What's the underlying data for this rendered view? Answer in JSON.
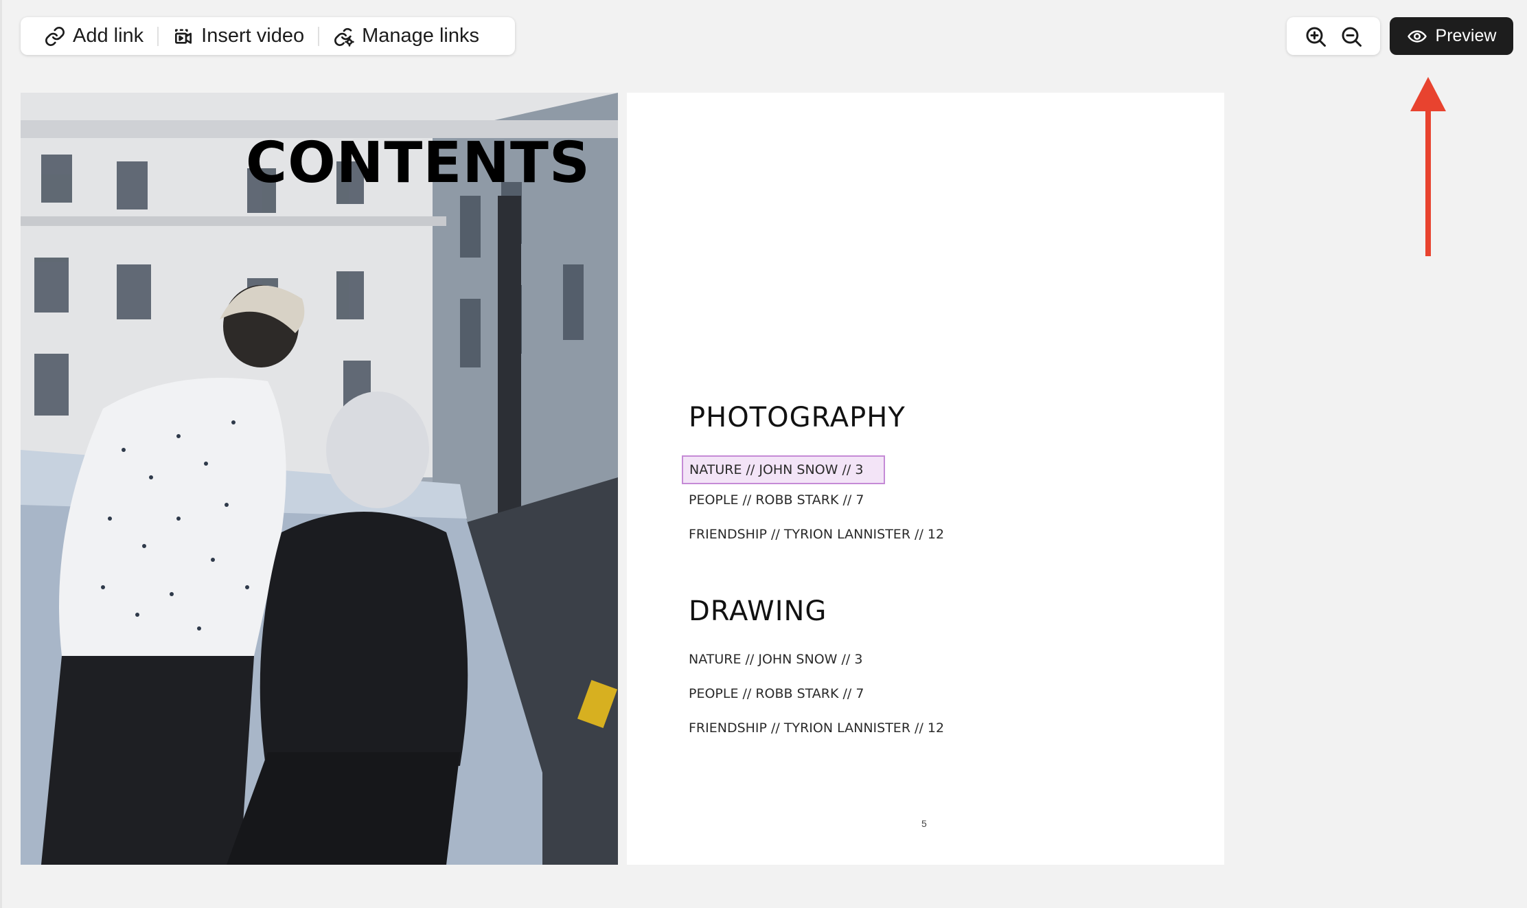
{
  "toolbar": {
    "add_link": "Add link",
    "insert_video": "Insert video",
    "manage_links": "Manage links"
  },
  "preview": {
    "label": "Preview"
  },
  "annotation": {
    "arrow_color": "#e8432f"
  },
  "left_page": {
    "title": "CONTENTS"
  },
  "right_page": {
    "sections": [
      {
        "heading": "PHOTOGRAPHY",
        "items": [
          "NATURE // JOHN SNOW //  3",
          "PEOPLE // ROBB STARK //  7",
          "FRIENDSHIP // TYRION LANNISTER // 12"
        ]
      },
      {
        "heading": "DRAWING",
        "items": [
          "NATURE // JOHN SNOW //  3",
          "PEOPLE // ROBB STARK //  7",
          "FRIENDSHIP // TYRION LANNISTER // 12"
        ]
      }
    ],
    "page_number": "5"
  }
}
